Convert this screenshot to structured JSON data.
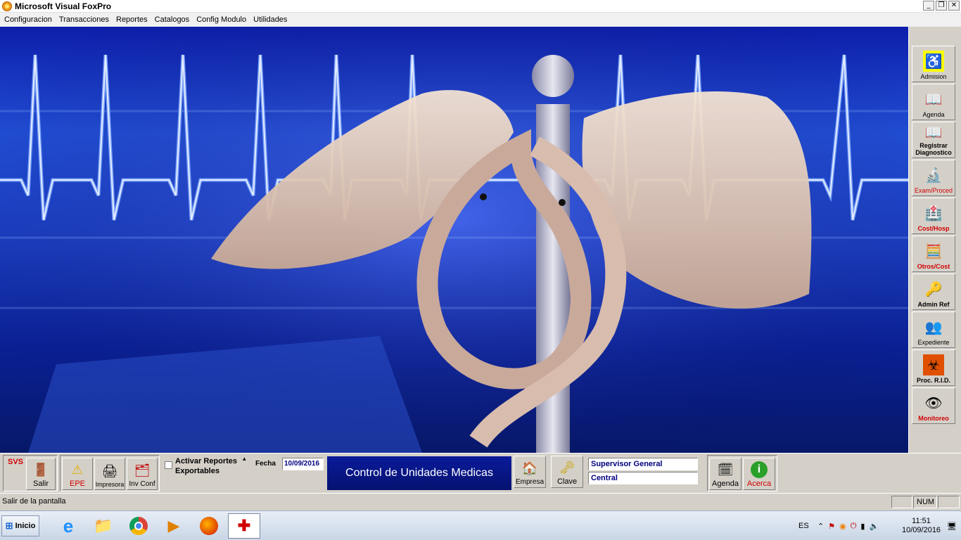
{
  "window": {
    "title": "Microsoft Visual FoxPro"
  },
  "menu": [
    "Configuracion",
    "Transacciones",
    "Reportes",
    "Catalogos",
    "Config Modulo",
    "Utilidades"
  ],
  "right_toolbar": [
    {
      "label": "Admision",
      "icon": "wheelchair-icon",
      "color": "#000000"
    },
    {
      "label": "Agenda",
      "icon": "book-icon",
      "color": "#000000"
    },
    {
      "label": "Registrar Diagnostico",
      "icon": "book-icon",
      "color": "#000000"
    },
    {
      "label": "Exam/Proced",
      "icon": "microscope-icon",
      "color": "#d00000"
    },
    {
      "label": "Cost/Hosp",
      "icon": "hospital-icon",
      "color": "#d00000"
    },
    {
      "label": "Otros/Cost",
      "icon": "calculator-icon",
      "color": "#d00000"
    },
    {
      "label": "Admin Ref",
      "icon": "key-icon",
      "color": "#000000"
    },
    {
      "label": "Expediente",
      "icon": "people-icon",
      "color": "#000000"
    },
    {
      "label": "Proc. R.I.D.",
      "icon": "biohazard-icon",
      "color": "#000000"
    },
    {
      "label": "Monitoreo",
      "icon": "eye-icon",
      "color": "#d00000"
    }
  ],
  "bottom_toolbar": {
    "svs": "SVS",
    "salir": "Salir",
    "epe": "EPE",
    "impresora": "Impresora",
    "inv_conf": "Inv Conf",
    "activar_line1": "Activar Reportes",
    "activar_line2": "Exportables",
    "fecha_label": "Fecha",
    "fecha_value": "10/09/2016",
    "banner": "Control de Unidades Medicas",
    "empresa": "Empresa",
    "clave": "Clave",
    "user": "Supervisor General",
    "branch": "Central",
    "agenda": "Agenda",
    "acerca": "Acerca"
  },
  "status": {
    "text": "Salir de la pantalla",
    "num": "NUM"
  },
  "taskbar": {
    "start": "Inicio",
    "lang": "ES",
    "time": "11:51",
    "date": "10/09/2016"
  },
  "colors": {
    "accent_red": "#d00000",
    "field_text": "#000080",
    "banner_bg": "#0a1a9a"
  }
}
